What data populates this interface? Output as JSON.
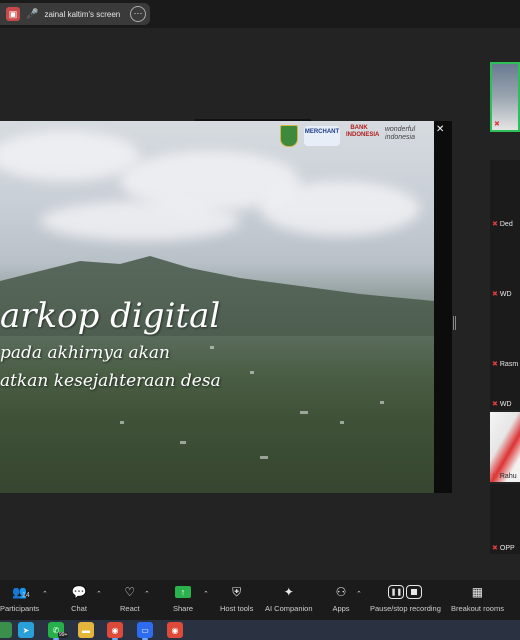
{
  "share_bar": {
    "title": "zainal kaltim's screen",
    "more_icon": "more-icon"
  },
  "slide": {
    "title": "arkop digital",
    "line1": "pada akhirnya akan",
    "line2": "atkan kesejahteraan desa",
    "logos": [
      "MERCHANT",
      "BANK INDONESIA",
      "wonderful indonesia"
    ]
  },
  "gallery": {
    "tiles": [
      {
        "name": ""
      },
      {
        "name": "Ded"
      },
      {
        "name": "WD"
      },
      {
        "name": "Rasm"
      },
      {
        "name": "WD"
      },
      {
        "name": "Rahu"
      },
      {
        "name": "OPP"
      }
    ]
  },
  "toolbar": {
    "participants_label": "Participants",
    "participants_count": "14",
    "chat_label": "Chat",
    "react_label": "React",
    "share_label": "Share",
    "host_tools_label": "Host tools",
    "ai_label": "AI Companion",
    "apps_label": "Apps",
    "record_label": "Pause/stop recording",
    "breakout_label": "Breakout rooms"
  },
  "taskbar": {
    "whatsapp_badge": "99+"
  },
  "colors": {
    "active_tile_border": "#2fbf5a",
    "share_green": "#2bb24c",
    "muted_red": "#e03b3b"
  }
}
